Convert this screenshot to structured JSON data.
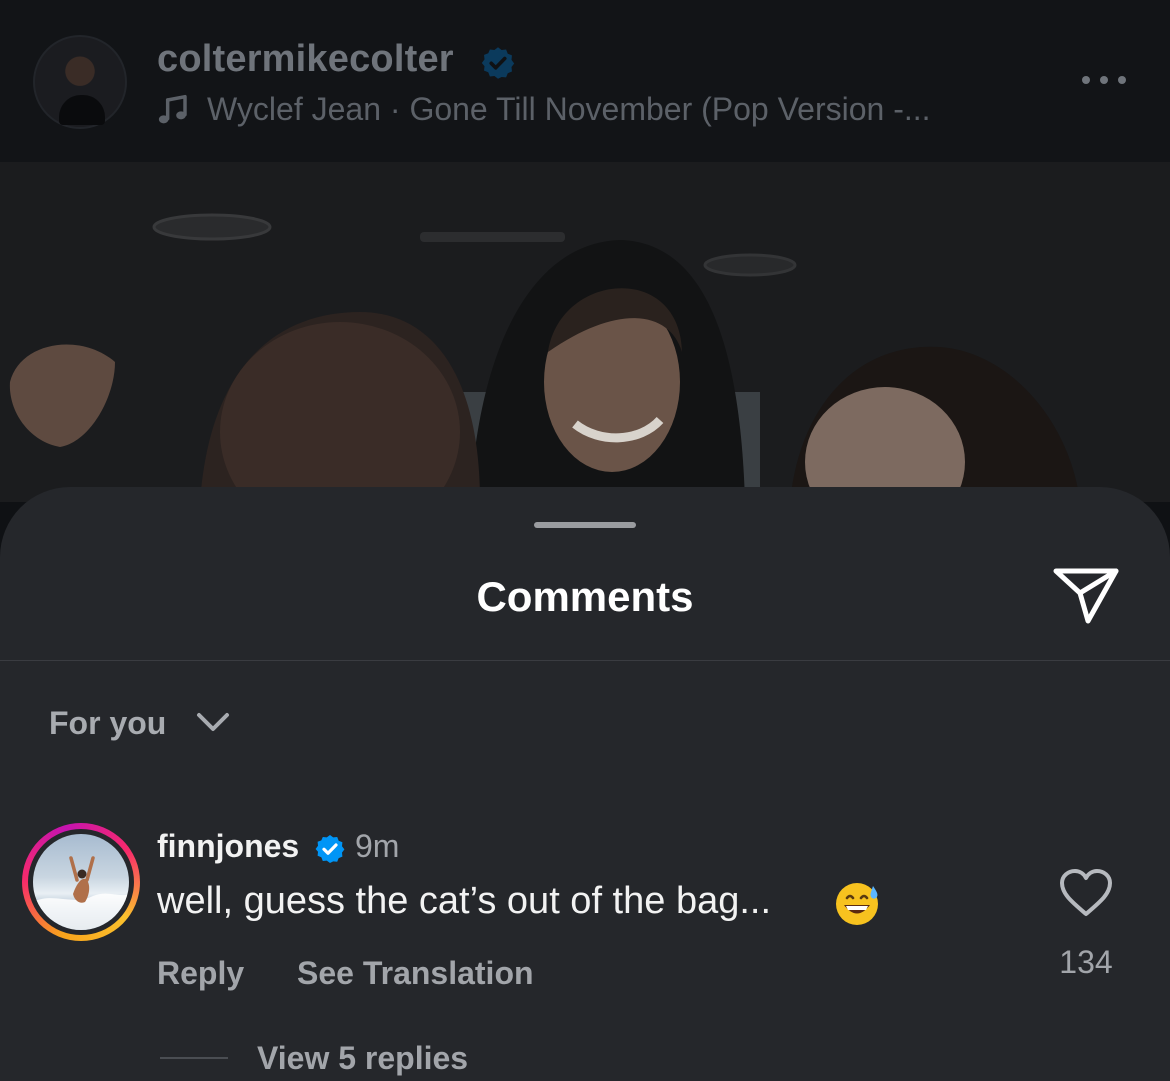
{
  "post": {
    "username": "coltermikecolter",
    "song": "Wyclef Jean · Gone Till November (Pop Version -..."
  },
  "sheet": {
    "title": "Comments",
    "filter": "For you"
  },
  "comment": {
    "username": "finnjones",
    "time": "9m",
    "text": "well, guess the cat’s out of the bag...",
    "reply_label": "Reply",
    "translate_label": "See Translation",
    "likes": "134",
    "view_replies": "View 5 replies"
  },
  "icons": {
    "verified": "verified-badge-icon",
    "music": "music-note-icon",
    "more": "more-options-icon",
    "share": "send-icon",
    "chevron": "chevron-down-icon",
    "heart": "heart-icon",
    "emoji": "grinning-sweat-emoji-icon"
  },
  "colors": {
    "sheet_background": "#25272b",
    "verified_blue": "#0095f6",
    "secondary_text": "#a2a5aa"
  }
}
